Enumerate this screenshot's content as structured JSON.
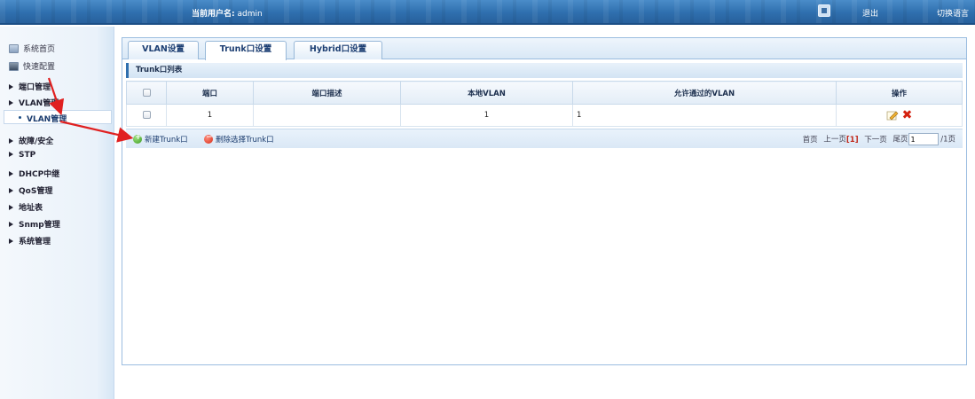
{
  "header": {
    "user_label": "当前用户名:",
    "user_name": "admin",
    "logout": "退出",
    "switch_lang": "切换语言"
  },
  "sidebar": {
    "items": [
      {
        "label": "系统首页",
        "icon": "home-icon"
      },
      {
        "label": "快速配置",
        "icon": "quick-config-icon"
      },
      {
        "label": "端口管理"
      },
      {
        "label": "VLAN管理"
      },
      {
        "label": "VLAN管理",
        "selected": true
      },
      {
        "label": "故障/安全"
      },
      {
        "label": "STP"
      },
      {
        "label": "DHCP中继"
      },
      {
        "label": "QoS管理"
      },
      {
        "label": "地址表"
      },
      {
        "label": "Snmp管理"
      },
      {
        "label": "系统管理"
      }
    ]
  },
  "tabs": [
    {
      "label": "VLAN设置"
    },
    {
      "label": "Trunk口设置",
      "active": true
    },
    {
      "label": "Hybrid口设置"
    }
  ],
  "list_title": "Trunk口列表",
  "table": {
    "columns": [
      "端口",
      "端口描述",
      "本地VLAN",
      "允许通过的VLAN",
      "操作"
    ],
    "rows": [
      {
        "port": "1",
        "desc": "",
        "local_vlan": "1",
        "allowed_vlan": "1"
      }
    ]
  },
  "toolbar": {
    "add_label": "新建Trunk口",
    "delete_label": "删除选择Trunk口"
  },
  "pager": {
    "first": "首页",
    "prev": "上一页",
    "current": "[1]",
    "next": "下一页",
    "last": "尾页",
    "page_input": "1",
    "total": "/1页"
  },
  "colors": {
    "header_blue": "#2f6fae",
    "annotation_red": "#e02020",
    "delete_red": "#d4210f"
  }
}
